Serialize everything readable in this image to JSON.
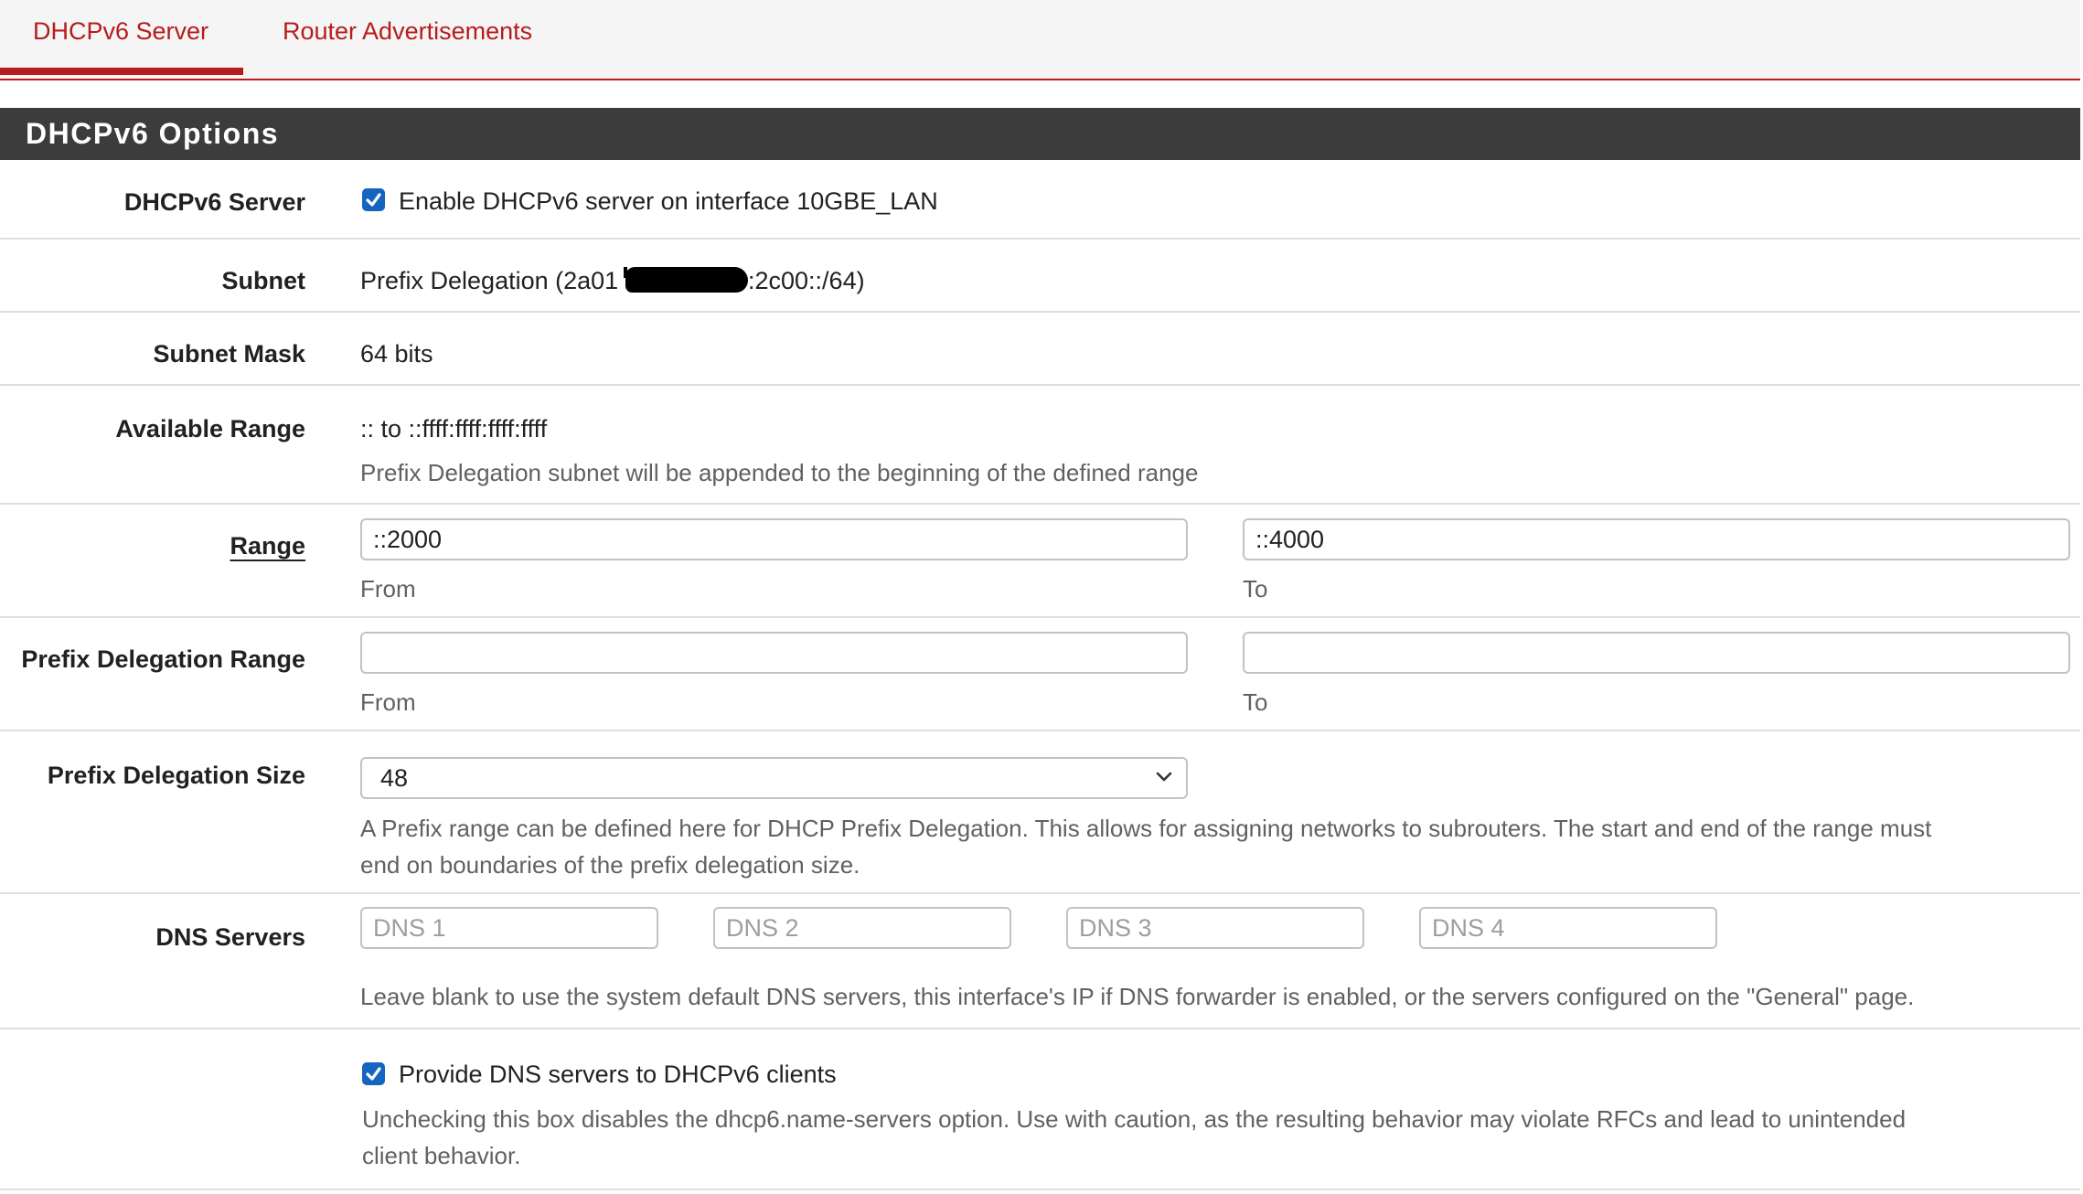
{
  "tabs": [
    {
      "label": "DHCPv6 Server",
      "active": true
    },
    {
      "label": "Router Advertisements",
      "active": false
    }
  ],
  "panel": {
    "title": "DHCPv6 Options"
  },
  "server": {
    "label": "DHCPv6 Server",
    "checkbox_label": "Enable DHCPv6 server on interface 10GBE_LAN",
    "checked": true
  },
  "subnet": {
    "label": "Subnet",
    "value_prefix": "Prefix Delegation (2a01",
    "value_suffix": ":2c00::/64)"
  },
  "subnet_mask": {
    "label": "Subnet Mask",
    "value": "64 bits"
  },
  "available_range": {
    "label": "Available Range",
    "value": ":: to ::ffff:ffff:ffff:ffff",
    "help": "Prefix Delegation subnet will be appended to the beginning of the defined range"
  },
  "range": {
    "label": "Range",
    "from_value": "::2000",
    "to_value": "::4000",
    "from_label": "From",
    "to_label": "To"
  },
  "pd_range": {
    "label": "Prefix Delegation Range",
    "from_value": "",
    "to_value": "",
    "from_label": "From",
    "to_label": "To"
  },
  "pd_size": {
    "label": "Prefix Delegation Size",
    "selected": "48",
    "help_line1": "A Prefix range can be defined here for DHCP Prefix Delegation. This allows for assigning networks to subrouters. The start and end of the range must",
    "help_line2": "end on boundaries of the prefix delegation size."
  },
  "dns": {
    "label": "DNS Servers",
    "placeholders": [
      "DNS 1",
      "DNS 2",
      "DNS 3",
      "DNS 4"
    ],
    "help": "Leave blank to use the system default DNS servers, this interface's IP if DNS forwarder is enabled, or the servers configured on the \"General\" page."
  },
  "provide_dns": {
    "checkbox_label": "Provide DNS servers to DHCPv6 clients",
    "checked": true,
    "help_line1": "Unchecking this box disables the dhcp6.name-servers option. Use with caution, as the resulting behavior may violate RFCs and lead to unintended",
    "help_line2": "client behavior."
  },
  "colors": {
    "accent": "#b71c1c",
    "header_bg": "#3c3c3c",
    "checkbox": "#1565c0"
  }
}
